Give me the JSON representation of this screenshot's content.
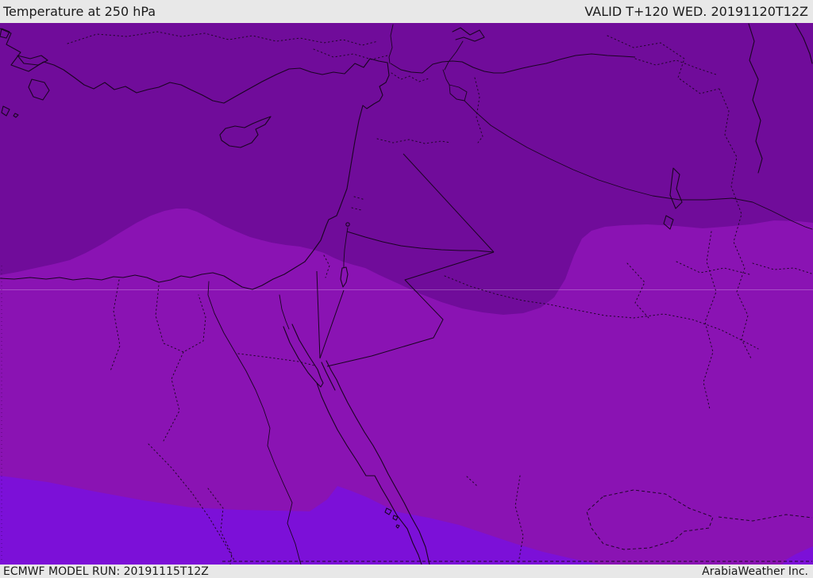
{
  "header": {
    "title": "Temperature at 250 hPa",
    "valid": "VALID T+120 WED. 20191120T12Z"
  },
  "footer": {
    "model_run": "ECMWF MODEL RUN: 20191115T12Z",
    "company": "ArabiaWeather Inc."
  },
  "map": {
    "parameter": "Temperature",
    "level": "250 hPa",
    "region": "Middle East / Eastern Mediterranean",
    "colors": {
      "band_dark": "#700c9a",
      "band_medium": "#8a13b3",
      "band_bright": "#7c10d8",
      "chrome_bg": "#e8e8e8",
      "chrome_text": "#1b1b1b",
      "line_color": "#1a0422"
    },
    "bands": [
      {
        "name": "coldest-band-north-and-jordan-lobe",
        "color": "#700c9a"
      },
      {
        "name": "middle-band",
        "color": "#8a13b3"
      },
      {
        "name": "warm-band-southwest",
        "color": "#7c10d8"
      }
    ]
  }
}
